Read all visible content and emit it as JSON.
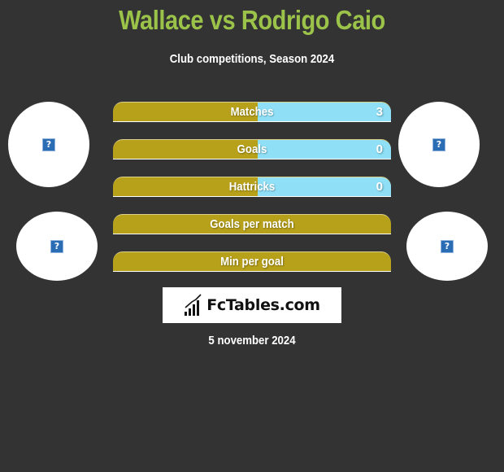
{
  "header": {
    "title": "Wallace vs Rodrigo Caio",
    "subtitle": "Club competitions, Season 2024"
  },
  "colors": {
    "background": "#333333",
    "title": "#9bc249",
    "left_bar": "#b8a11a",
    "right_bar": "#8fe0f7"
  },
  "avatars": {
    "left_top_icon": "image-placeholder-icon",
    "left_bottom_icon": "image-placeholder-icon",
    "right_top_icon": "image-placeholder-icon",
    "right_bottom_icon": "image-placeholder-icon",
    "placeholder_glyph": "?"
  },
  "stats": [
    {
      "label": "Matches",
      "left_value": "",
      "right_value": "3",
      "right_share": 0.48
    },
    {
      "label": "Goals",
      "left_value": "",
      "right_value": "0",
      "right_share": 0.48
    },
    {
      "label": "Hattricks",
      "left_value": "",
      "right_value": "0",
      "right_share": 0.48
    },
    {
      "label": "Goals per match",
      "left_value": "",
      "right_value": "",
      "right_share": 0
    },
    {
      "label": "Min per goal",
      "left_value": "",
      "right_value": "",
      "right_share": 0
    }
  ],
  "logo": {
    "text": "FcTables.com",
    "icon": "bar-chart-icon"
  },
  "footer": {
    "date": "5 november 2024"
  }
}
